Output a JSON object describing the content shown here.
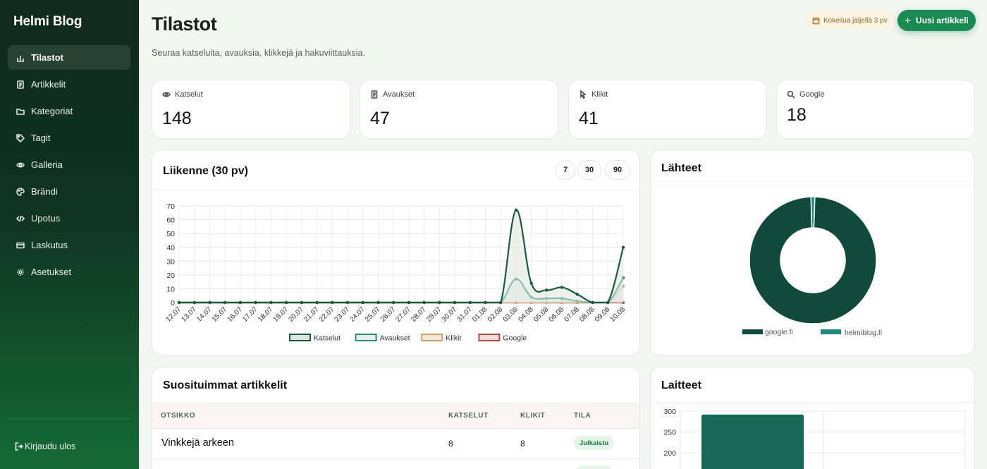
{
  "sidebar": {
    "brand": "Helmi Blog",
    "items": [
      {
        "label": "Tilastot",
        "icon": "bar-chart-icon",
        "active": true
      },
      {
        "label": "Artikkelit",
        "icon": "document-icon"
      },
      {
        "label": "Kategoriat",
        "icon": "folder-icon"
      },
      {
        "label": "Tagit",
        "icon": "tag-icon"
      },
      {
        "label": "Galleria",
        "icon": "eye-icon"
      },
      {
        "label": "Brändi",
        "icon": "palette-icon"
      },
      {
        "label": "Upotus",
        "icon": "code-icon"
      },
      {
        "label": "Laskutus",
        "icon": "credit-card-icon"
      },
      {
        "label": "Asetukset",
        "icon": "settings-icon"
      }
    ],
    "logout": "Kirjaudu ulos"
  },
  "header": {
    "title": "Tilastot",
    "subtitle": "Seuraa katseluita, avauksia, klikkejä ja hakuviittauksia.",
    "trial": "Kokeilua jäljellä 3 pv",
    "new_button": "Uusi artikkeli"
  },
  "stats": [
    {
      "label": "Katselut",
      "value": "148",
      "icon": "eye-icon"
    },
    {
      "label": "Avaukset",
      "value": "47",
      "icon": "document-icon"
    },
    {
      "label": "Klikit",
      "value": "41",
      "icon": "cursor-icon"
    },
    {
      "label": "Google",
      "value": "18",
      "icon": "search-icon"
    }
  ],
  "traffic": {
    "title": "Liikenne (30 pv)",
    "ranges": [
      "7",
      "30",
      "90"
    ]
  },
  "sources": {
    "title": "Lähteet"
  },
  "devices": {
    "title": "Laitteet"
  },
  "popular": {
    "title": "Suosituimmat artikkelit",
    "columns": [
      "OTSIKKO",
      "KATSELUT",
      "KLIKIT",
      "TILA"
    ],
    "rows": [
      {
        "title": "Vinkkejä arkeen",
        "views": "8",
        "clicks": "8",
        "status": "Julkaistu"
      }
    ]
  },
  "chart_data": [
    {
      "type": "line",
      "x": [
        "12.07",
        "13.07",
        "14.07",
        "15.07",
        "16.07",
        "17.07",
        "18.07",
        "19.07",
        "20.07",
        "21.07",
        "22.07",
        "23.07",
        "24.07",
        "25.07",
        "26.07",
        "27.07",
        "28.07",
        "29.07",
        "30.07",
        "31.07",
        "01.08",
        "02.08",
        "03.08",
        "04.08",
        "05.08",
        "06.08",
        "07.08",
        "08.08",
        "09.08",
        "10.08"
      ],
      "ylim": [
        0,
        70
      ],
      "yticks": [
        0,
        10,
        20,
        30,
        40,
        50,
        60,
        70
      ],
      "grid": true,
      "legend": "bottom",
      "series": [
        {
          "name": "Katselut",
          "color": "#1f5a3f",
          "fill": "#dde6e0",
          "values": [
            0,
            0,
            0,
            0,
            0,
            0,
            0,
            0,
            0,
            0,
            0,
            0,
            0,
            0,
            0,
            0,
            0,
            0,
            0,
            0,
            0,
            0,
            67,
            14,
            9,
            11,
            6,
            0,
            0,
            40
          ]
        },
        {
          "name": "Avaukset",
          "color": "#2e8a74",
          "fill": "#e5efe9",
          "values": [
            0,
            0,
            0,
            0,
            0,
            0,
            0,
            0,
            0,
            0,
            0,
            0,
            0,
            0,
            0,
            0,
            0,
            0,
            0,
            0,
            0,
            0,
            17,
            4,
            3,
            3,
            1,
            0,
            0,
            18
          ]
        },
        {
          "name": "Klikit",
          "color": "#c9a46a",
          "fill": "#f1e8da",
          "values": [
            0,
            0,
            0,
            0,
            0,
            0,
            0,
            0,
            0,
            0,
            0,
            0,
            0,
            0,
            0,
            0,
            0,
            0,
            0,
            0,
            0,
            0,
            0,
            0,
            0,
            0,
            0,
            0,
            0,
            12
          ]
        },
        {
          "name": "Google",
          "color": "#b04a44",
          "fill": "#f0dcdb",
          "values": [
            0,
            0,
            0,
            0,
            0,
            0,
            0,
            0,
            0,
            0,
            0,
            0,
            0,
            0,
            0,
            0,
            0,
            0,
            0,
            0,
            0,
            0,
            0,
            0,
            0,
            0,
            0,
            0,
            0,
            0
          ]
        }
      ]
    },
    {
      "type": "pie",
      "legend": "bottom",
      "categories": [
        "google.fi",
        "helmiblog.fi"
      ],
      "values": [
        99,
        1
      ],
      "colors": [
        "#0f4a3a",
        "#1f8a7a"
      ]
    },
    {
      "type": "bar",
      "yticks": [
        200,
        250,
        300
      ],
      "ylim": [
        200,
        300
      ],
      "values": [
        292
      ],
      "color": "#176858"
    }
  ]
}
